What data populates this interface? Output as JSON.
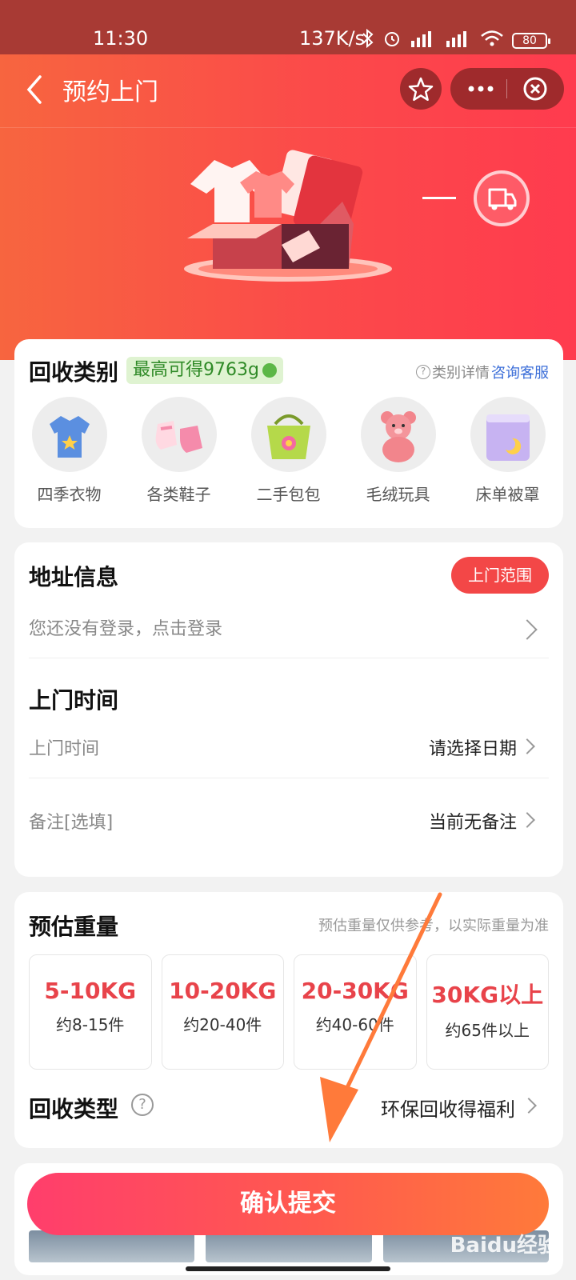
{
  "status_bar": {
    "time": "11:30",
    "network_speed": "137K/s",
    "battery": "80"
  },
  "nav": {
    "title": "预约上门"
  },
  "category": {
    "title": "回收类别",
    "badge": "最高可得9763g",
    "help_text": "类别详情",
    "help_link": "咨询客服",
    "items": [
      {
        "label": "四季衣物",
        "icon": "tshirt-icon"
      },
      {
        "label": "各类鞋子",
        "icon": "shoes-icon"
      },
      {
        "label": "二手包包",
        "icon": "bag-icon"
      },
      {
        "label": "毛绒玩具",
        "icon": "teddy-bear-icon"
      },
      {
        "label": "床单被罩",
        "icon": "bedding-icon"
      }
    ]
  },
  "address": {
    "title": "地址信息",
    "scope_button": "上门范围",
    "login_prompt": "您还没有登录，点击登录"
  },
  "visit": {
    "title": "上门时间",
    "time_label": "上门时间",
    "time_value": "请选择日期",
    "note_label": "备注[选填]",
    "note_value": "当前无备注"
  },
  "weight": {
    "title": "预估重量",
    "note": "预估重量仅供参考，以实际重量为准",
    "options": [
      {
        "kg": "5-10KG",
        "count": "约8-15件"
      },
      {
        "kg": "10-20KG",
        "count": "约20-40件"
      },
      {
        "kg": "20-30KG",
        "count": "约40-60件"
      },
      {
        "kg": "30KG以上",
        "count": "约65件以上"
      }
    ]
  },
  "recycle_type": {
    "title": "回收类型",
    "value": "环保回收得福利"
  },
  "submit": {
    "label": "确认提交"
  },
  "watermark": "Baidu经验",
  "colors": {
    "accent": "#f34747",
    "weight_text": "#e8434a",
    "annotation_arrow": "#ff7a3a"
  }
}
